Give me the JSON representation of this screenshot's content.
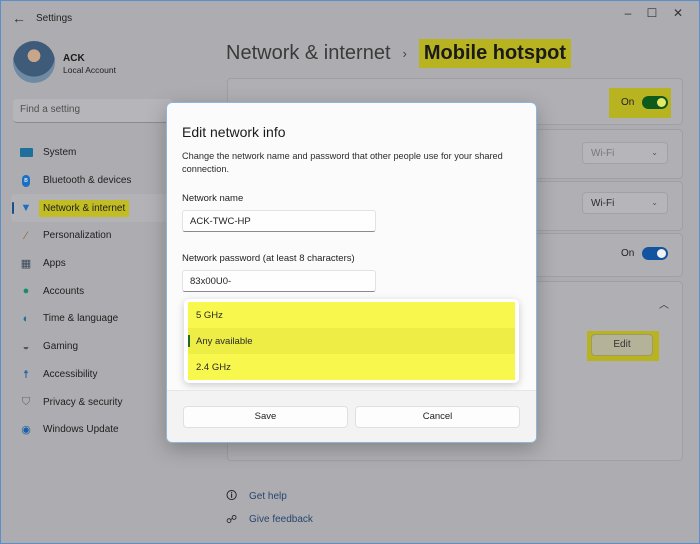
{
  "window": {
    "app_title": "Settings",
    "back_icon": "arrow-left-icon",
    "controls": {
      "minimize": "–",
      "maximize": "☐",
      "close": "✕"
    }
  },
  "profile": {
    "name": "ACK",
    "account_type": "Local Account"
  },
  "search": {
    "placeholder": "Find a setting"
  },
  "sidebar": {
    "items": [
      {
        "label": "System",
        "icon": "system-icon",
        "active": false
      },
      {
        "label": "Bluetooth & devices",
        "icon": "bluetooth-icon",
        "active": false
      },
      {
        "label": "Network & internet",
        "icon": "wifi-icon",
        "active": true
      },
      {
        "label": "Personalization",
        "icon": "brush-icon",
        "active": false
      },
      {
        "label": "Apps",
        "icon": "apps-icon",
        "active": false
      },
      {
        "label": "Accounts",
        "icon": "person-icon",
        "active": false
      },
      {
        "label": "Time & language",
        "icon": "globe-clock-icon",
        "active": false
      },
      {
        "label": "Gaming",
        "icon": "gamepad-icon",
        "active": false
      },
      {
        "label": "Accessibility",
        "icon": "accessibility-icon",
        "active": false
      },
      {
        "label": "Privacy & security",
        "icon": "shield-icon",
        "active": false
      },
      {
        "label": "Windows Update",
        "icon": "update-icon",
        "active": false
      }
    ]
  },
  "header": {
    "parent": "Network & internet",
    "separator": "›",
    "current": "Mobile hotspot"
  },
  "settings": {
    "hotspot_toggle": {
      "state_label": "On",
      "enabled": true
    },
    "share_from": {
      "value": "Wi-Fi"
    },
    "share_over": {
      "value": "Wi-Fi"
    },
    "power_saving_toggle": {
      "state_label": "On",
      "enabled": true
    },
    "properties": {
      "edit_label": "Edit",
      "expanded": true
    }
  },
  "help": {
    "get_help": "Get help",
    "give_feedback": "Give feedback"
  },
  "dialog": {
    "title": "Edit network info",
    "description": "Change the network name and password that other people use for your shared connection.",
    "network_name_label": "Network name",
    "network_name_value": "ACK-TWC-HP",
    "password_label": "Network password (at least 8 characters)",
    "password_value": "83x00U0-",
    "band_options": [
      {
        "label": "5 GHz",
        "selected": false
      },
      {
        "label": "Any available",
        "selected": true
      },
      {
        "label": "2.4 GHz",
        "selected": false
      }
    ],
    "save_label": "Save",
    "cancel_label": "Cancel"
  }
}
